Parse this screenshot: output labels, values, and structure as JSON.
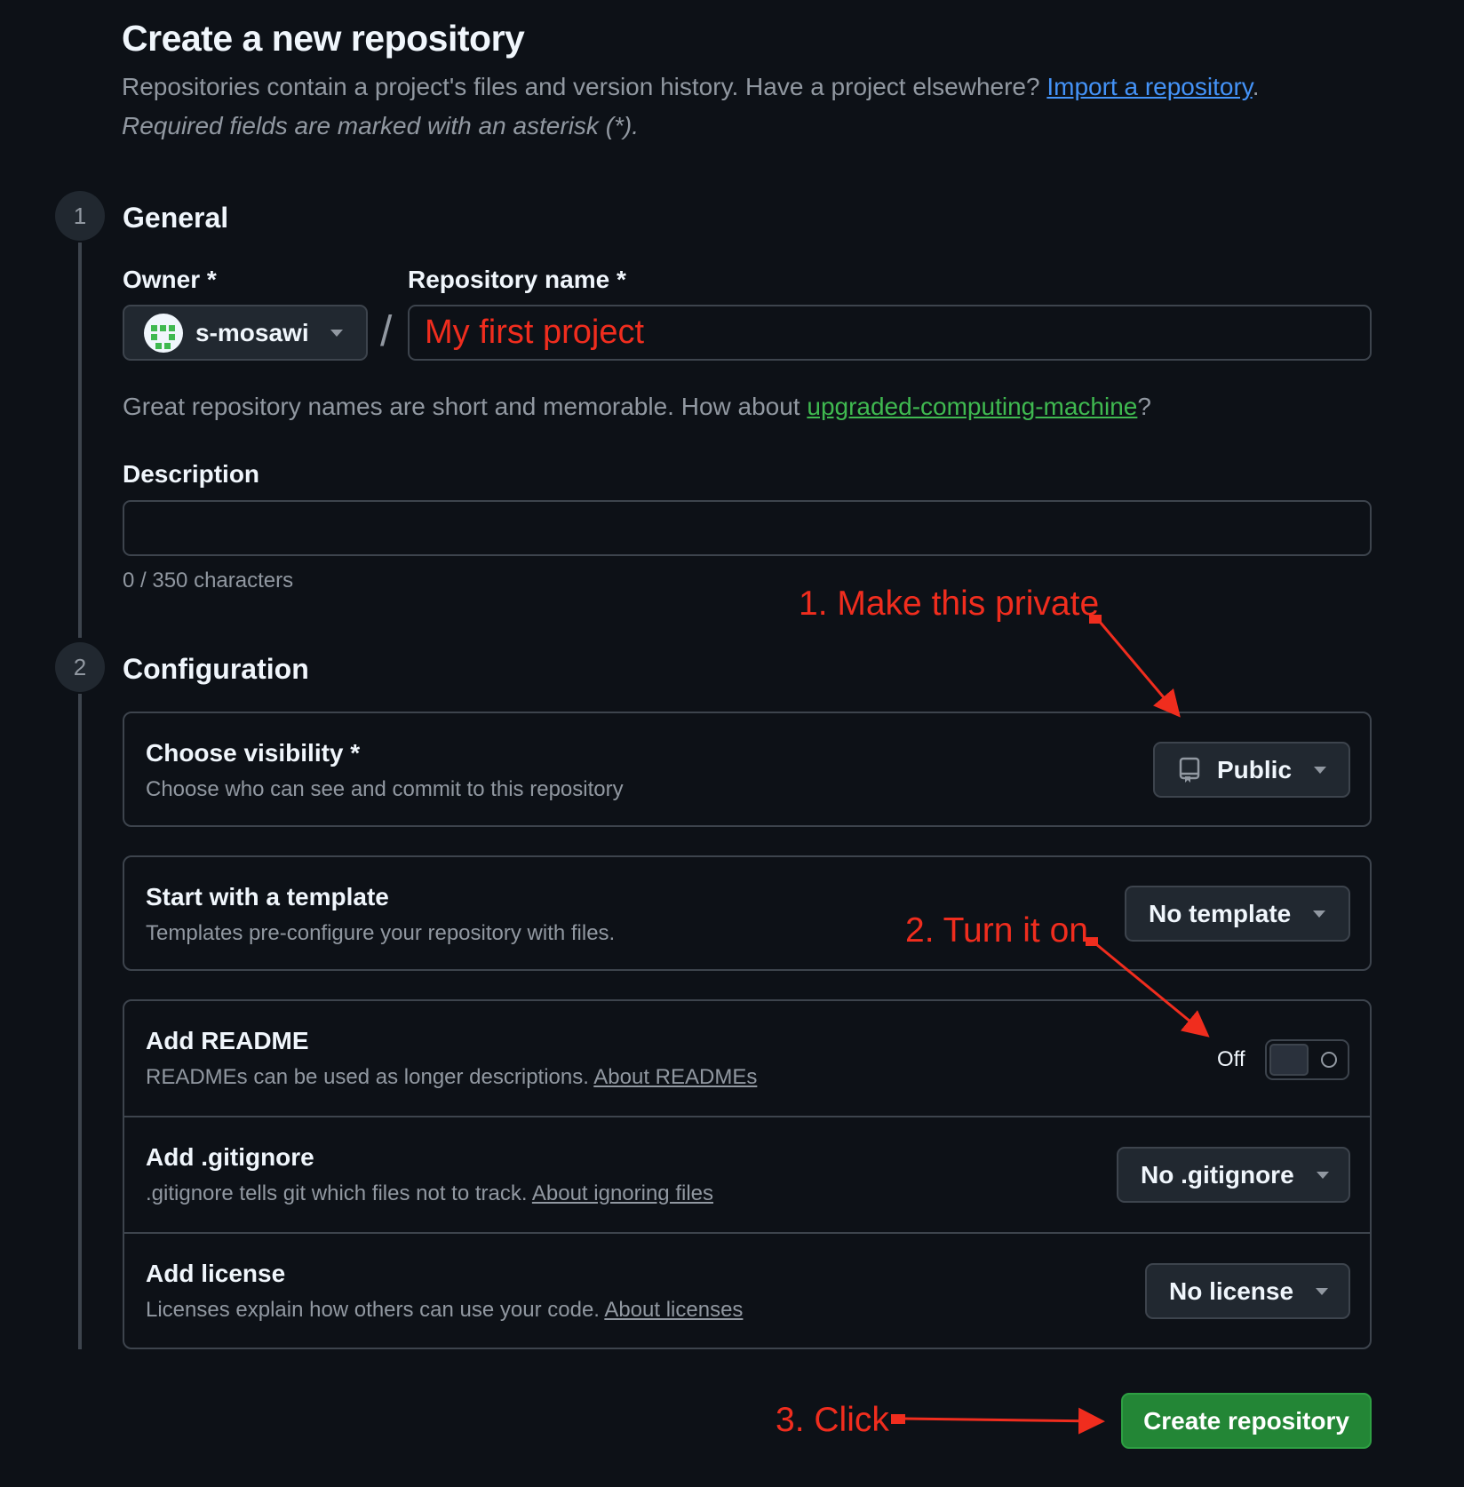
{
  "header": {
    "title": "Create a new repository",
    "subtitle": "Repositories contain a project's files and version history. Have a project elsewhere?",
    "import_link": "Import a repository",
    "subtitle_end": ".",
    "required_note": "Required fields are marked with an asterisk (*)."
  },
  "general": {
    "step": "1",
    "heading": "General",
    "owner_label": "Owner *",
    "owner_value": "s-mosawi",
    "slash": "/",
    "repo_name_label": "Repository name *",
    "repo_name_value": "My first project",
    "hint_text": "Great repository names are short and memorable. How about",
    "hint_suggestion": "upgraded-computing-machine",
    "hint_end": "?",
    "description_label": "Description",
    "description_value": "",
    "char_count": "0 / 350 characters"
  },
  "configuration": {
    "step": "2",
    "heading": "Configuration",
    "visibility": {
      "title": "Choose visibility *",
      "desc": "Choose who can see and commit to this repository",
      "value": "Public",
      "icon": "repo-icon"
    },
    "template": {
      "title": "Start with a template",
      "desc": "Templates pre-configure your repository with files.",
      "value": "No template"
    },
    "readme": {
      "title": "Add README",
      "desc": "READMEs can be used as longer descriptions.",
      "link": "About READMEs",
      "toggle_label": "Off",
      "enabled": false
    },
    "gitignore": {
      "title": "Add .gitignore",
      "desc": ".gitignore tells git which files not to track.",
      "link": "About ignoring files",
      "value": "No .gitignore"
    },
    "license": {
      "title": "Add license",
      "desc": "Licenses explain how others can use your code.",
      "link": "About licenses",
      "value": "No license"
    }
  },
  "create_button": "Create repository",
  "annotations": {
    "a1": "1. Make this private",
    "a2": "2. Turn it on",
    "a3": "3. Click",
    "color": "#f02d1e"
  },
  "colors": {
    "background": "#0d1117",
    "link": "#4493f8",
    "suggestion": "#3fb950",
    "primary_button": "#238636"
  }
}
